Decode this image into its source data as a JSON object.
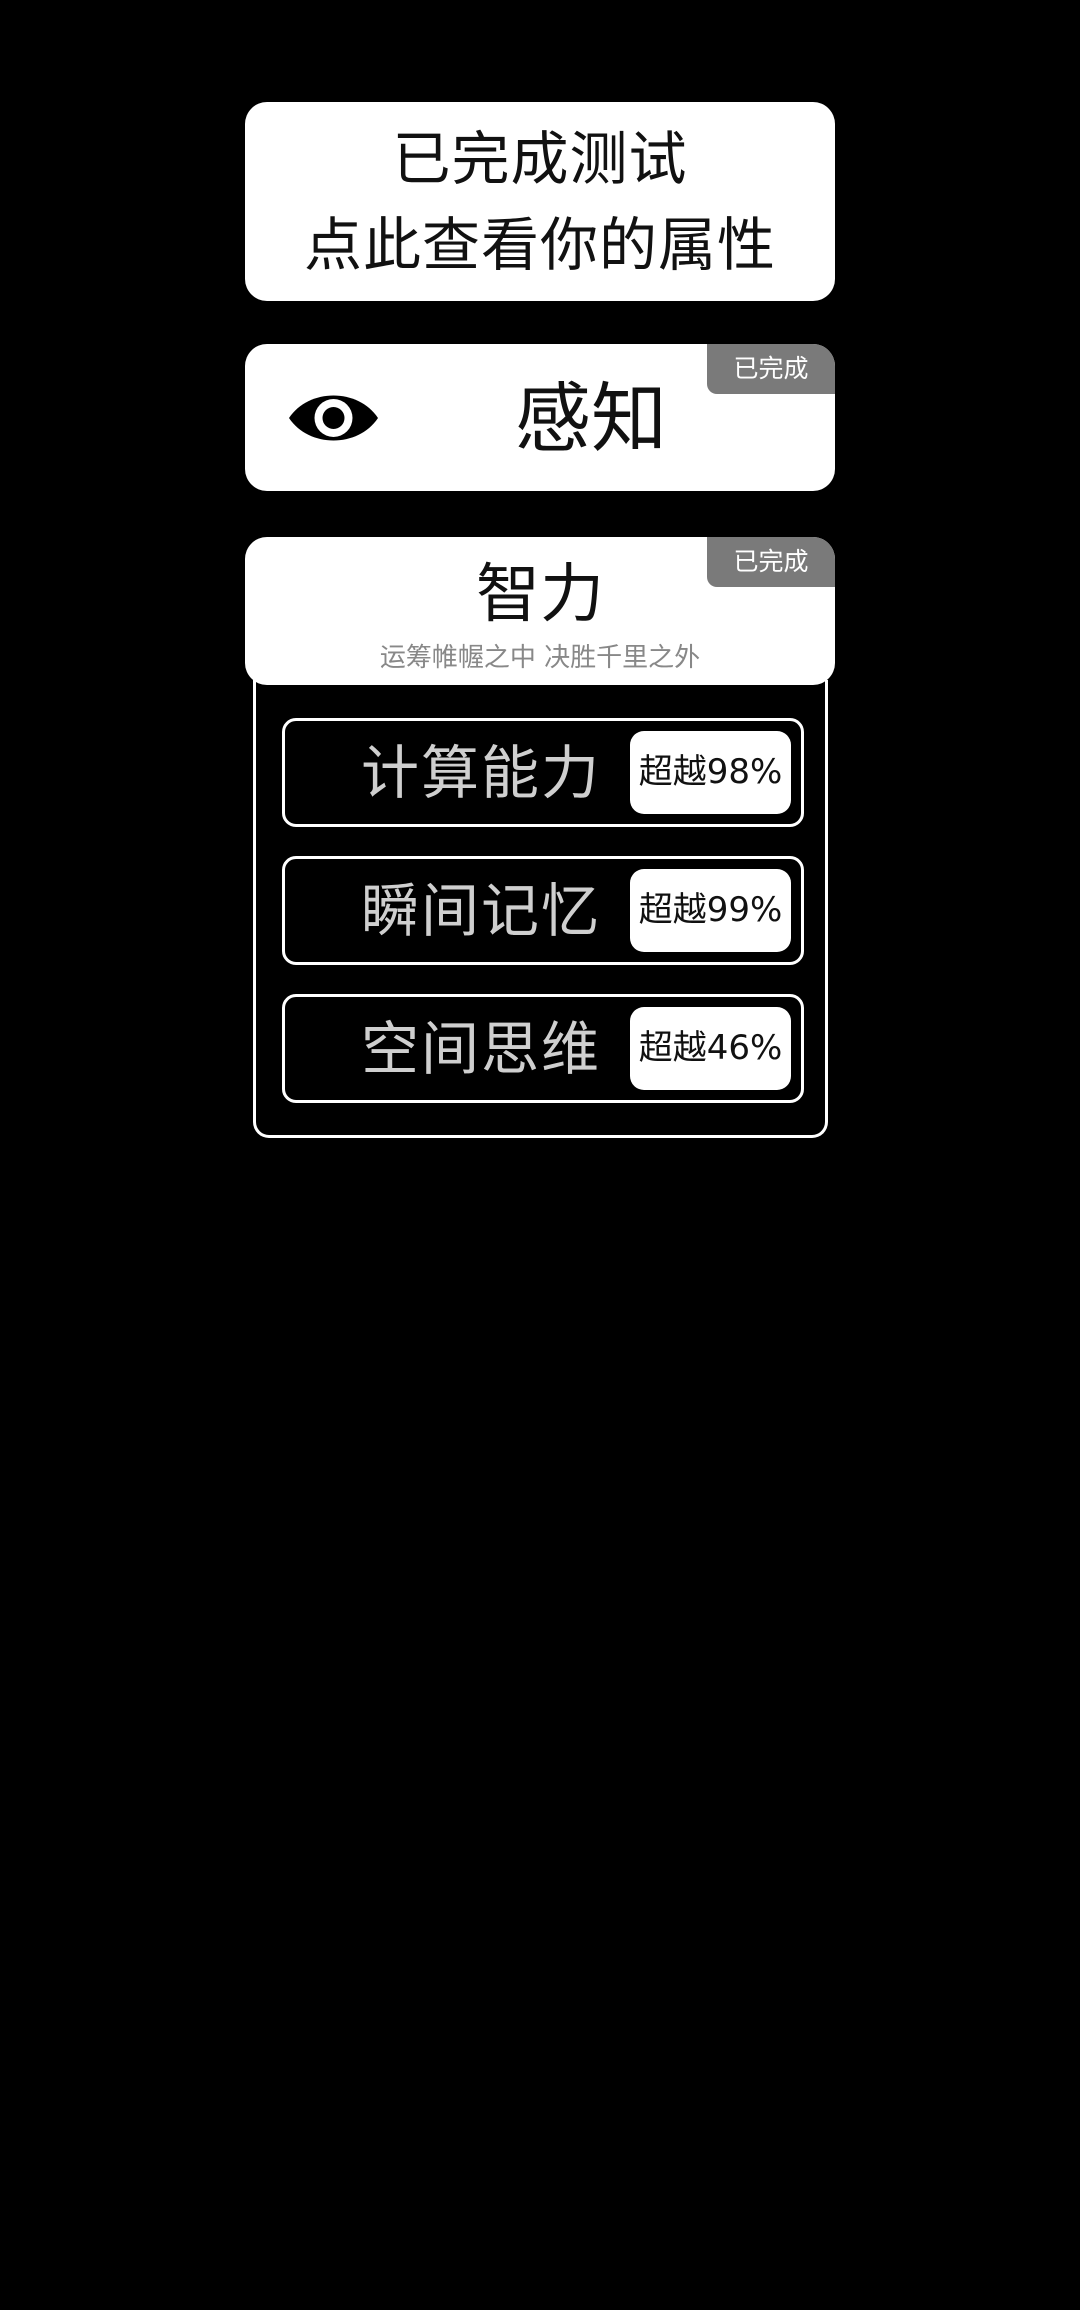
{
  "summary": {
    "line1": "已完成测试",
    "line2": "点此查看你的属性"
  },
  "perception": {
    "title": "感知",
    "badge": "已完成",
    "icon": "eye-icon"
  },
  "intelligence": {
    "title": "智力",
    "subtitle": "运筹帷幄之中 决胜千里之外",
    "badge": "已完成",
    "skills": [
      {
        "name": "计算能力",
        "result": "超越98%"
      },
      {
        "name": "瞬间记忆",
        "result": "超越99%"
      },
      {
        "name": "空间思维",
        "result": "超越46%"
      }
    ]
  },
  "colors": {
    "background": "#000000",
    "card": "#ffffff",
    "badge": "#7a7a7a",
    "subtitle": "#888888"
  }
}
